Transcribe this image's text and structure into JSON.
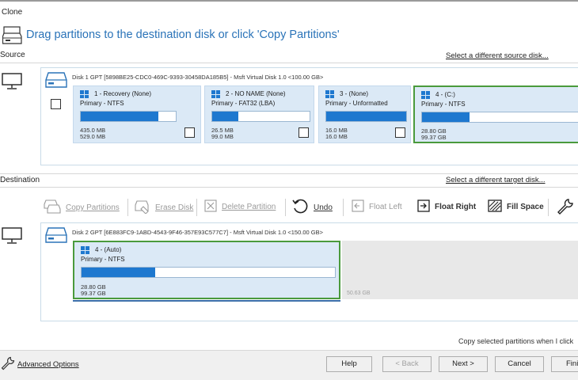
{
  "window": {
    "title": "Clone"
  },
  "header": {
    "instruction": "Drag partitions to the destination disk or click 'Copy Partitions'"
  },
  "source": {
    "label": "Source",
    "select_link": "Select a different source disk...",
    "disk": {
      "info": "Disk 1 GPT [5898BE25-CDC0-469C-9393-30458DA185B5] - Msft    Virtual Disk    1.0  <100.00 GB>",
      "partitions": [
        {
          "name": "1 - Recovery (None)",
          "type": "Primary - NTFS",
          "used": "435.0 MB",
          "total": "529.0 MB",
          "fill": 0.82
        },
        {
          "name": "2 - NO NAME (None)",
          "type": "Primary - FAT32 (LBA)",
          "used": "26.5 MB",
          "total": "99.0 MB",
          "fill": 0.27
        },
        {
          "name": "3 - (None)",
          "type": "Primary - Unformatted",
          "used": "16.0 MB",
          "total": "16.0 MB",
          "fill": 1.0
        },
        {
          "name": "4 - (C:)",
          "type": "Primary - NTFS",
          "used": "28.80 GB",
          "total": "99.37 GB",
          "fill": 0.29
        }
      ]
    }
  },
  "destination": {
    "label": "Destination",
    "select_link": "Select a different target disk...",
    "toolbar": {
      "copy_partitions": "Copy Partitions",
      "erase_disk": "Erase Disk",
      "delete_partition": "Delete Partition",
      "undo": "Undo",
      "float_left": "Float Left",
      "float_right": "Float Right",
      "fill_space": "Fill Space"
    },
    "disk": {
      "info": "Disk 2 GPT [6E883FC9-1ABD-4543-9F46-357E93C577C7] - Msft    Virtual Disk    1.0  <150.00 GB>",
      "partition": {
        "name": "4 - (Auto)",
        "type": "Primary - NTFS",
        "used": "28.80 GB",
        "total": "99.37 GB",
        "fill": 0.29
      },
      "unallocated": "50.63 GB"
    },
    "note": "Copy selected partitions when I click"
  },
  "footer": {
    "advanced_options": "Advanced Options",
    "help": "Help",
    "back": "< Back",
    "next": "Next >",
    "cancel": "Cancel",
    "finish": "Fini"
  },
  "colors": {
    "accent": "#1e78cf",
    "title_blue": "#2a73b8",
    "selected_border": "#4a9a3c",
    "partition_bg": "#dbe9f6"
  }
}
